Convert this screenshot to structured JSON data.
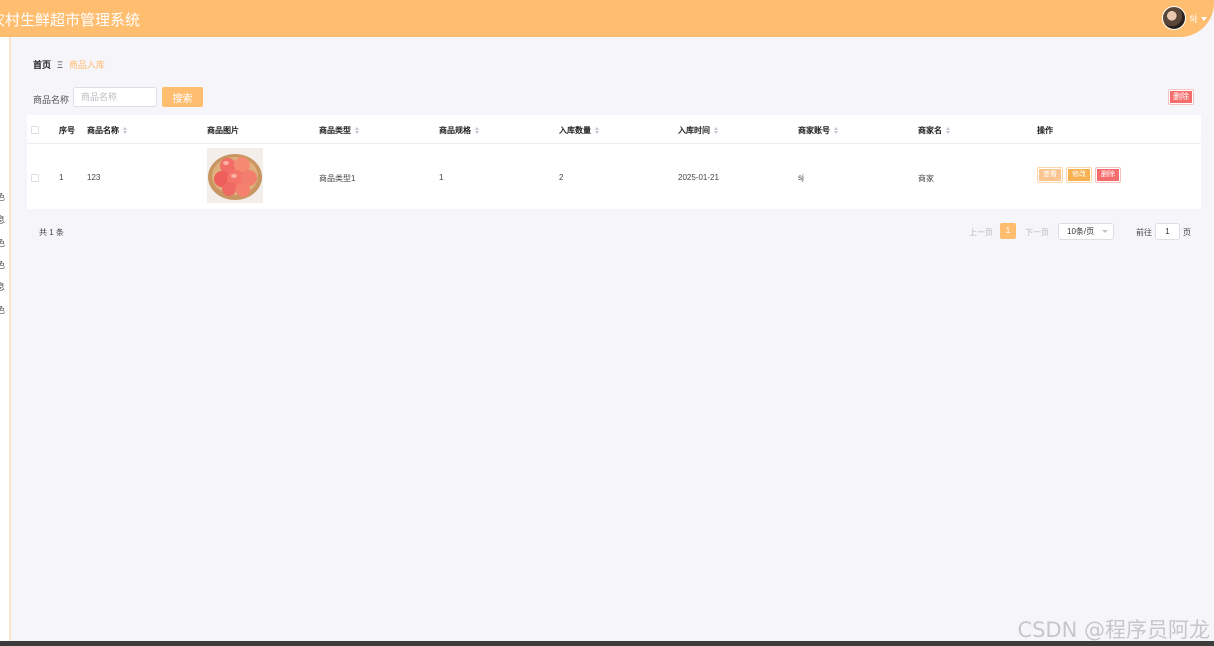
{
  "header": {
    "app_title": "农村生鲜超市管理系统",
    "username": "sj"
  },
  "sidebar": {
    "items": [
      "色",
      "息",
      "色",
      "色",
      "息",
      "色"
    ]
  },
  "breadcrumb": {
    "home": "首页",
    "current": "商品入库"
  },
  "search": {
    "label": "商品名称",
    "placeholder": "商品名称",
    "button_label": "搜索",
    "batch_delete_label": "删除"
  },
  "table": {
    "columns": [
      "序号",
      "商品名称",
      "商品图片",
      "商品类型",
      "商品规格",
      "入库数量",
      "入库时间",
      "商家账号",
      "商家名",
      "操作"
    ],
    "rows": [
      {
        "index": "1",
        "name": "123",
        "type": "商品类型1",
        "spec": "1",
        "quantity": "2",
        "date": "2025-01-21",
        "account": "sj",
        "merchant": "商家",
        "actions": {
          "view": "查看",
          "edit": "修改",
          "delete": "删除"
        }
      }
    ]
  },
  "pagination": {
    "total": "共 1 条",
    "prev": "上一页",
    "current_page": "1",
    "next": "下一页",
    "page_size": "10条/页",
    "goto_label": "前往",
    "goto_value": "1",
    "page_unit": "页"
  },
  "watermark": "CSDN @程序员阿龙",
  "colors": {
    "accent": "#ffbd70",
    "danger": "#f56c6c",
    "warning": "#f7b150"
  }
}
